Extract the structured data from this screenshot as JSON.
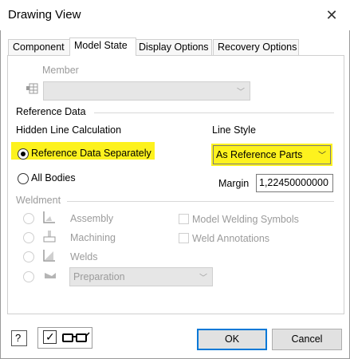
{
  "window": {
    "title": "Drawing View"
  },
  "tabs": [
    "Component",
    "Model State",
    "Display Options",
    "Recovery Options"
  ],
  "active_tab": "Model State",
  "member": {
    "label": "Member",
    "value": ""
  },
  "reference_data": {
    "section_label": "Reference Data",
    "hidden_line_label": "Hidden Line Calculation",
    "option_separately": "Reference Data Separately",
    "option_all_bodies": "All Bodies",
    "selected": "Reference Data Separately",
    "line_style_label": "Line Style",
    "line_style_value": "As Reference Parts",
    "margin_label": "Margin",
    "margin_value": "1,22450000000"
  },
  "weldment": {
    "section_label": "Weldment",
    "options": [
      "Assembly",
      "Machining",
      "Welds"
    ],
    "preparation_value": "Preparation",
    "model_welding_symbols": "Model Welding Symbols",
    "weld_annotations": "Weld Annotations"
  },
  "footer": {
    "ok": "OK",
    "cancel": "Cancel"
  },
  "colors": {
    "highlight": "#fdf21e",
    "primary_border": "#0078d7"
  }
}
